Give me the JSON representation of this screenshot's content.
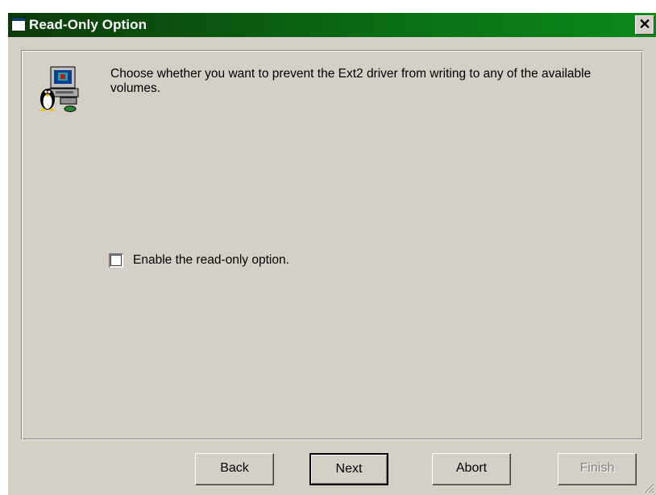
{
  "window": {
    "title": "Read-Only Option",
    "close_label": "✕"
  },
  "content": {
    "description": "Choose whether you want to prevent the Ext2 driver from writing to any of the available volumes.",
    "checkbox_label": "Enable the read-only option.",
    "checkbox_checked": false
  },
  "buttons": {
    "back": "Back",
    "next": "Next",
    "abort": "Abort",
    "finish": "Finish"
  },
  "icons": {
    "title": "window-icon",
    "wizard": "linux-computer-icon",
    "close": "close-icon",
    "grip": "resize-grip-icon"
  },
  "colors": {
    "titlebar": "#0b6a14",
    "face": "#d4d0c8"
  }
}
